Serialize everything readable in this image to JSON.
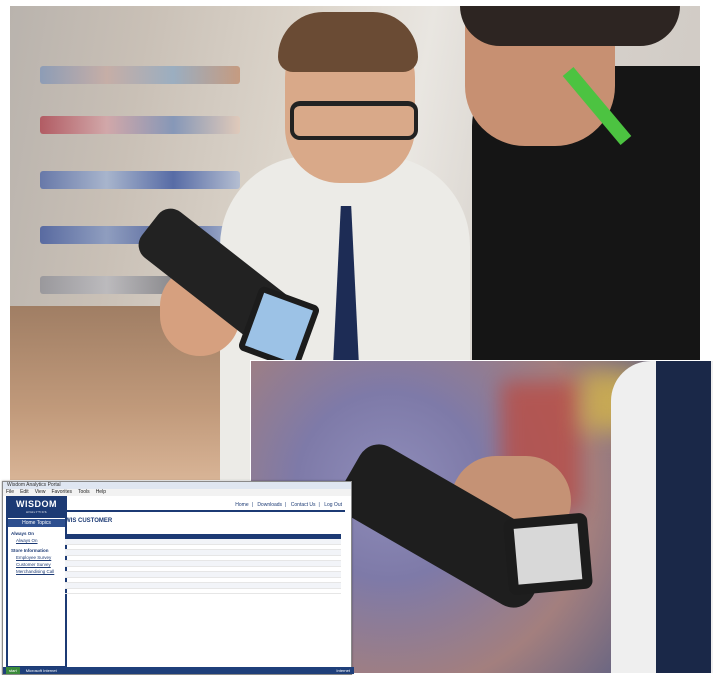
{
  "app": {
    "title": "Wisdom Analytics Portal",
    "menu": [
      "File",
      "Edit",
      "View",
      "Favorites",
      "Tools",
      "Help"
    ]
  },
  "sidebar": {
    "brand": "WISDOM",
    "brand_sub": "ANALYTICS",
    "home_topics": "Home Topics",
    "section1": "Always On",
    "link1": "Always On",
    "section2": "Store Information",
    "link2": "Employee Survey",
    "link3": "Customer Survey",
    "link4": "Merchandising Call"
  },
  "topnav": [
    "Home",
    "Downloads",
    "Contact Us",
    "Log Out"
  ],
  "content": {
    "title": "WIS CUSTOMER",
    "subtitle": ""
  },
  "table": {
    "rows": 10,
    "cols": 13
  },
  "statusbar": {
    "start": "start",
    "task": "Microsoft Internet",
    "right": "Internet"
  }
}
